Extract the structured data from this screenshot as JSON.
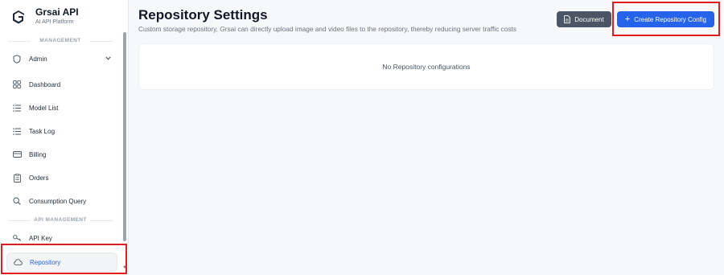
{
  "brand": {
    "name": "Grsai API",
    "subtitle": "AI API Platform"
  },
  "sidebar": {
    "section_management": "MANAGEMENT",
    "section_api": "API MANAGEMENT",
    "items": [
      {
        "label": "Admin",
        "icon": "shield-icon"
      },
      {
        "label": "Dashboard",
        "icon": "dashboard-icon"
      },
      {
        "label": "Model List",
        "icon": "list-icon"
      },
      {
        "label": "Task Log",
        "icon": "list-icon"
      },
      {
        "label": "Billing",
        "icon": "card-icon"
      },
      {
        "label": "Orders",
        "icon": "clipboard-icon"
      },
      {
        "label": "Consumption Query",
        "icon": "search-icon"
      },
      {
        "label": "API Key",
        "icon": "key-icon"
      },
      {
        "label": "Repository",
        "icon": "cloud-icon",
        "active": true
      }
    ]
  },
  "main": {
    "title": "Repository Settings",
    "subtitle": "Custom storage repository, Grsai can directly upload image and video files to the repository, thereby reducing server traffic costs",
    "document_button": "Document",
    "create_button": "Create Repository Config",
    "empty_text": "No Repository configurations"
  },
  "colors": {
    "accent": "#2563eb",
    "document_button_bg": "#4b5563",
    "highlight": "#e11d1d"
  }
}
